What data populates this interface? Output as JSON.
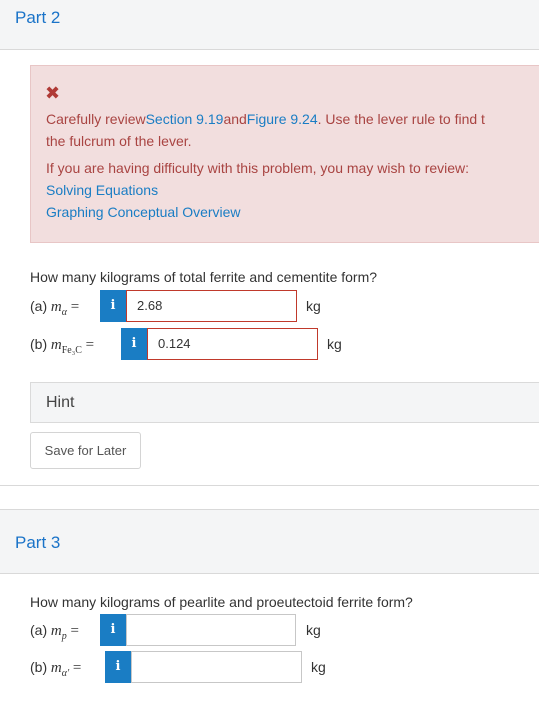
{
  "part2": {
    "title": "Part 2",
    "feedback": {
      "line1_pre": "Carefully review",
      "link_section": "Section 9.19",
      "line1_and": "and",
      "link_figure": "Figure 9.24",
      "line1_post": ". Use the lever rule to find t",
      "line2": "the fulcrum of the lever.",
      "line3": "If you are having difficulty with this problem, you may wish to review:",
      "link_solving": "Solving Equations",
      "link_graphing": "Graphing Conceptual Overview"
    },
    "question": "How many kilograms of total ferrite and cementite form?",
    "answers": [
      {
        "prefix": "(a)",
        "var": "m",
        "sub": "α",
        "value": "2.68",
        "unit": "kg"
      },
      {
        "prefix": "(b)",
        "var": "m",
        "sub": "Fe₃C",
        "value": "0.124",
        "unit": "kg"
      }
    ],
    "hint_label": "Hint",
    "save_label": "Save for Later"
  },
  "part3": {
    "title": "Part 3",
    "question": "How many kilograms of pearlite and proeutectoid ferrite form?",
    "answers": [
      {
        "prefix": "(a)",
        "var": "m",
        "sub": "p",
        "value": "",
        "unit": "kg"
      },
      {
        "prefix": "(b)",
        "var": "m",
        "sub": "α′",
        "value": "",
        "unit": "kg"
      }
    ]
  },
  "icons": {
    "info": "i",
    "error": "✖"
  },
  "colors": {
    "link": "#1a7dc4",
    "error_bg": "#f2dede",
    "error_text": "#a94442"
  }
}
